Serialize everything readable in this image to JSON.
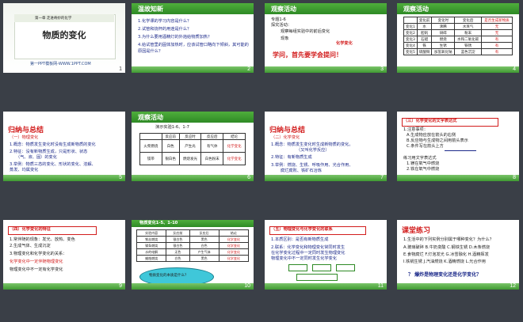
{
  "slides": [
    {
      "num": "1",
      "chapter": "第一章 走进奇妙的化学",
      "title": "物质的变化",
      "footer": "第一PPT模板网-WWW.1PPT.COM"
    },
    {
      "num": "2",
      "header": "温故知新",
      "lines": [
        "1.化学课的学习内容是什么？",
        "2.试管和烧杯的用途是什么？",
        "3.为什么要用酒精灯的外焰给物质加热？",
        "4.给试管里的固体加热时，应该试管口略向下倾斜，其可能的原因是什么？"
      ]
    },
    {
      "num": "3",
      "header": "观察活动",
      "lines": [
        "专题1-6",
        "探究活动：",
        "观察每组实验中的前后变化",
        "现象",
        "化学变化",
        "学问，首先要学会提问！"
      ]
    },
    {
      "num": "4",
      "header": "观察活动",
      "table": [
        [
          "",
          "变化前",
          "变化时",
          "变化后",
          "是否生成新物质"
        ],
        [
          "变化1",
          "水",
          "沸腾",
          "水蒸气",
          "无"
        ],
        [
          "变化2",
          "胆矾",
          "研碎",
          "粉末",
          "无"
        ],
        [
          "变化3",
          "石蜡",
          "燃烧",
          "水和二氧化碳",
          "有"
        ],
        [
          "变化4",
          "铁",
          "生锈",
          "铁锈",
          "有"
        ],
        [
          "变化5",
          "硫酸铜",
          "加氢氧化钠",
          "蓝色沉淀",
          "有"
        ]
      ]
    },
    {
      "num": "5",
      "header": "归纳与总结",
      "lines": [
        "（一）物理变化",
        "1.概念：物质发生变化时没有生成新物质的变化",
        "2.特征：没有新物质生成，只是形状、状态",
        "（气、液、固）的变化",
        "3.举例：物质三态的变化、形状的变化、溶解、",
        "蒸发、均属变化"
      ]
    },
    {
      "num": "6",
      "header": "观察活动",
      "sub": "演示实验1-6、1-7",
      "table": [
        [
          "",
          "反应前",
          "反应时",
          "反应后",
          "结论"
        ],
        [
          "火柴燃烧",
          "白色",
          "产生光",
          "有气体",
          "化学变化"
        ],
        [
          "镁带",
          "银白色",
          "燃烧发光",
          "白色粉末",
          "化学变化"
        ]
      ]
    },
    {
      "num": "7",
      "header": "归纳与总结",
      "lines": [
        "（二）化学变化",
        "1.概念：物质发生变化时生成新物质的变化。",
        "（又叫化学反应）",
        "2.特征：有新物质生成",
        "3.举例：燃烧、生锈、呼吸作用、光合作用、",
        "腐烂腐败、铁矿石冶炼"
      ]
    },
    {
      "num": "8",
      "header": "（三）化学变化的文字表达式",
      "lines": [
        "1.注意事项：",
        "A.生成物应放在箭头的右侧",
        "B.反应物与生成物之间用箭头表示",
        "C.条件写在箭头上方",
        "练习用文字表达式",
        "1.镁在氧气中燃烧",
        "2.铁在氧气中燃烧"
      ]
    },
    {
      "num": "9",
      "header": "（四）化学变化的特征",
      "lines": [
        "1.常伴随的现象：发光、放热、变色",
        "2.生成气体、生成沉淀",
        "3.物理变化和化学变化的关系：",
        "化学变化中一定伴随物理变化",
        "物理变化中不一定有化学变化"
      ]
    },
    {
      "num": "10",
      "header": "物质变化1-5、1-10",
      "table": [
        [
          "实验内容",
          "反应前",
          "反应后",
          "结论"
        ],
        [
          "铁丝燃烧",
          "银白色",
          "黑色",
          "化学变化"
        ],
        [
          "镁条燃烧",
          "银白色",
          "白色",
          "化学变化"
        ],
        [
          "水的电解",
          "无色",
          "产生气体",
          "化学变化"
        ],
        [
          "蜡烛燃烧",
          "白色",
          "黑色",
          "化学变化"
        ]
      ],
      "bubble": "物质变化的本质是什么？"
    },
    {
      "num": "11",
      "header": "（五）物理变化与化学变化的联系",
      "lines": [
        "1.本质区别：是否有新物质生成",
        "2.联系：化学变化和物理变化常同时发生",
        "在化学变化过程中一定同时发生物理变化",
        "物理变化中不一定同时发生化学变化"
      ]
    },
    {
      "num": "12",
      "header": "课堂练习",
      "lines": [
        "1.生活中的下列实例分别属于哪种变化？为什么？",
        "A.玻璃破碎  B.牛奶变酸  C.钢铁生锈  D.木条燃烧",
        "E.食物腐烂  F.灯泡发光  G.冰雪融化  H.酒精挥发",
        "I.铁锅生锈  J.汽油燃烧  K.酒精燃烧  L.光合作用",
        "？ 爆炸是物理变化还是化学变化？"
      ]
    }
  ]
}
